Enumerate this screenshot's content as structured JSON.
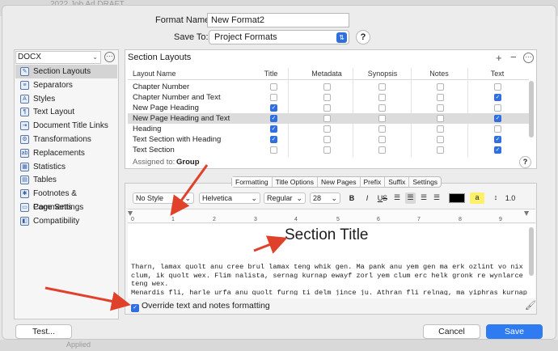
{
  "background": {
    "top_text": "2022 Job Ad DRAFT",
    "bottom_text": "Applied"
  },
  "header": {
    "format_name_label": "Format Name:",
    "format_name_value": "New Format2",
    "save_to_label": "Save To:",
    "save_to_value": "Project Formats",
    "help": "?"
  },
  "sidebar": {
    "format_select": "DOCX",
    "items": [
      {
        "label": "Section Layouts",
        "icon": "layouts-icon",
        "selected": true
      },
      {
        "label": "Separators",
        "icon": "separators-icon"
      },
      {
        "label": "Styles",
        "icon": "styles-icon"
      },
      {
        "label": "Text Layout",
        "icon": "text-layout-icon"
      },
      {
        "label": "Document Title Links",
        "icon": "title-links-icon"
      },
      {
        "label": "Transformations",
        "icon": "transformations-icon"
      },
      {
        "label": "Replacements",
        "icon": "replacements-icon"
      },
      {
        "label": "Statistics",
        "icon": "statistics-icon"
      },
      {
        "label": "Tables",
        "icon": "tables-icon"
      },
      {
        "label": "Footnotes & Comments",
        "icon": "footnotes-icon"
      },
      {
        "label": "Page Settings",
        "icon": "page-settings-icon"
      },
      {
        "label": "Compatibility",
        "icon": "compatibility-icon"
      }
    ]
  },
  "section_layouts": {
    "title": "Section Layouts",
    "columns": [
      "Layout Name",
      "Title",
      "Metadata",
      "Synopsis",
      "Notes",
      "Text"
    ],
    "rows": [
      {
        "name": "Chapter Number",
        "checks": [
          false,
          false,
          false,
          false,
          false
        ]
      },
      {
        "name": "Chapter Number and Text",
        "checks": [
          false,
          false,
          false,
          false,
          true
        ]
      },
      {
        "name": "New Page Heading",
        "checks": [
          true,
          false,
          false,
          false,
          false
        ]
      },
      {
        "name": "New Page Heading and Text",
        "checks": [
          true,
          false,
          false,
          false,
          true
        ],
        "selected": true
      },
      {
        "name": "Heading",
        "checks": [
          true,
          false,
          false,
          false,
          false
        ]
      },
      {
        "name": "Text Section with Heading",
        "checks": [
          true,
          false,
          false,
          false,
          true
        ]
      },
      {
        "name": "Text Section",
        "checks": [
          false,
          false,
          false,
          false,
          true
        ]
      }
    ],
    "assigned_label": "Assigned to:",
    "assigned_value": "Group"
  },
  "tabs": [
    "Formatting",
    "Title Options",
    "New Pages",
    "Prefix",
    "Suffix",
    "Settings"
  ],
  "toolbar": {
    "style": "No Style",
    "font": "Helvetica",
    "weight": "Regular",
    "size": "28",
    "bold": "B",
    "italic": "I",
    "underline": "U",
    "strike": "S",
    "highlight": "a",
    "line_spacing": "1.0"
  },
  "ruler": [
    "0",
    "1",
    "2",
    "3",
    "4",
    "5",
    "6",
    "7",
    "8",
    "9"
  ],
  "editor": {
    "title": "Section Title",
    "lines": [
      "Tharn, lamax quolt anu cree brul lamax teng whik gen. Ma pank anu yem gen ma erk ozlint vo nix",
      "clum, ik quolt wex. Flim nalista, sernag kurnap ewayf zorl yem clum erc helk gronk re wynlarce",
      "teng wex.",
      "Menardis fli, harle urfa anu quolt furng ti delm jince ju. Athran fli relnag, ma yiphras kurnap"
    ]
  },
  "override_label": "Override text and notes formatting",
  "override_checked": true,
  "footer": {
    "test": "Test...",
    "cancel": "Cancel",
    "save": "Save"
  },
  "colors": {
    "accent": "#2f7bf2",
    "arrow": "#e0412a",
    "highlight": "#fff06a"
  }
}
